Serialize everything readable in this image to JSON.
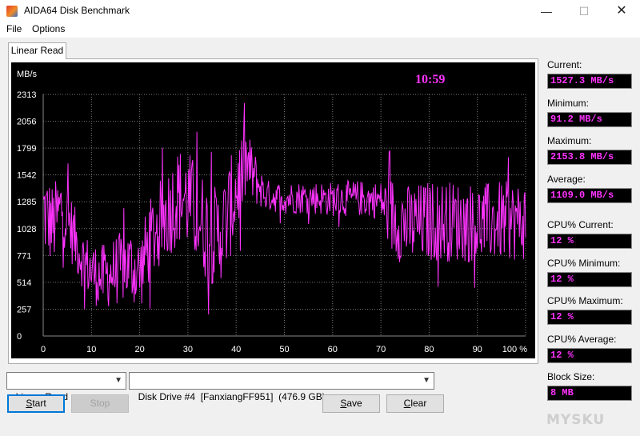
{
  "window": {
    "title": "AIDA64 Disk Benchmark",
    "minimize_glyph": "—",
    "maximize_glyph": "☐",
    "close_glyph": "✕"
  },
  "menu": {
    "file": "File",
    "options": "Options"
  },
  "tab": {
    "label": "Linear Read"
  },
  "chart_data": {
    "type": "line",
    "ylabel": "MB/s",
    "yticks": [
      0,
      257,
      514,
      771,
      1028,
      1285,
      1542,
      1799,
      2056,
      2313
    ],
    "ylim": [
      0,
      2313
    ],
    "xticks": [
      "0",
      "10",
      "20",
      "30",
      "40",
      "50",
      "60",
      "70",
      "80",
      "90",
      "100 %"
    ],
    "xlim": [
      0,
      100
    ],
    "clock": "10:59",
    "grid": true,
    "series_color": "#ff33ff",
    "series": [
      {
        "envelope": [
          {
            "x": 0,
            "y": 1200
          },
          {
            "x": 2,
            "y": 1050
          },
          {
            "x": 4,
            "y": 1250
          },
          {
            "x": 6,
            "y": 1000
          },
          {
            "x": 8,
            "y": 750
          },
          {
            "x": 10,
            "y": 620
          },
          {
            "x": 12,
            "y": 560
          },
          {
            "x": 14,
            "y": 600
          },
          {
            "x": 16,
            "y": 650
          },
          {
            "x": 18,
            "y": 680
          },
          {
            "x": 20,
            "y": 600
          },
          {
            "x": 22,
            "y": 900
          },
          {
            "x": 24,
            "y": 1050
          },
          {
            "x": 26,
            "y": 1200
          },
          {
            "x": 28,
            "y": 1350
          },
          {
            "x": 30,
            "y": 1300
          },
          {
            "x": 32,
            "y": 1150
          },
          {
            "x": 34,
            "y": 1000
          },
          {
            "x": 36,
            "y": 950
          },
          {
            "x": 38,
            "y": 1100
          },
          {
            "x": 40,
            "y": 1400
          },
          {
            "x": 42,
            "y": 1650
          },
          {
            "x": 44,
            "y": 1500
          },
          {
            "x": 46,
            "y": 1350
          },
          {
            "x": 50,
            "y": 1320
          },
          {
            "x": 55,
            "y": 1330
          },
          {
            "x": 60,
            "y": 1310
          },
          {
            "x": 65,
            "y": 1320
          },
          {
            "x": 70,
            "y": 1300
          },
          {
            "x": 72,
            "y": 1150
          },
          {
            "x": 76,
            "y": 1050
          },
          {
            "x": 80,
            "y": 1100
          },
          {
            "x": 85,
            "y": 1100
          },
          {
            "x": 90,
            "y": 1080
          },
          {
            "x": 95,
            "y": 1100
          },
          {
            "x": 100,
            "y": 1100
          }
        ],
        "jitter": [
          {
            "x": 0,
            "y": 450
          },
          {
            "x": 8,
            "y": 280
          },
          {
            "x": 20,
            "y": 380
          },
          {
            "x": 30,
            "y": 500
          },
          {
            "x": 40,
            "y": 480
          },
          {
            "x": 46,
            "y": 150
          },
          {
            "x": 70,
            "y": 180
          },
          {
            "x": 72,
            "y": 400
          },
          {
            "x": 100,
            "y": 380
          }
        ]
      }
    ]
  },
  "stats": {
    "current_label": "Current:",
    "current_value": "1527.3 MB/s",
    "minimum_label": "Minimum:",
    "minimum_value": "91.2 MB/s",
    "maximum_label": "Maximum:",
    "maximum_value": "2153.8 MB/s",
    "average_label": "Average:",
    "average_value": "1109.0 MB/s",
    "cpu_current_label": "CPU% Current:",
    "cpu_current_value": "12 %",
    "cpu_minimum_label": "CPU% Minimum:",
    "cpu_minimum_value": "12 %",
    "cpu_maximum_label": "CPU% Maximum:",
    "cpu_maximum_value": "12 %",
    "cpu_average_label": "CPU% Average:",
    "cpu_average_value": "12 %",
    "block_size_label": "Block Size:",
    "block_size_value": "8 MB"
  },
  "controls": {
    "test_select": "Linear Read",
    "drive_select": "Disk Drive #4  [FanxiangFF951]  (476.9 GB)",
    "dropdown_glyph": "▼",
    "start_key": "S",
    "start_rest": "tart",
    "stop_label": "Stop",
    "save_key": "S",
    "save_rest": "ave",
    "clear_key": "C",
    "clear_rest": "lear"
  },
  "watermark": "MYSKU"
}
